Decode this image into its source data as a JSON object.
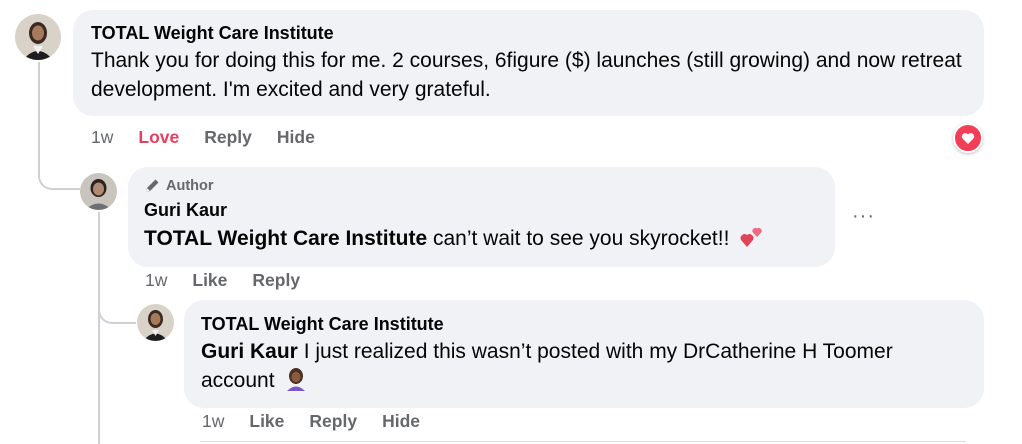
{
  "comment1": {
    "author": "TOTAL Weight Care Institute",
    "text": "Thank you for doing this for me. 2 courses, 6figure ($) launches (still growing) and now retreat development. I'm excited and very grateful.",
    "time": "1w",
    "love_label": "Love",
    "reply_label": "Reply",
    "hide_label": "Hide",
    "reaction_icon": "love-reaction-icon",
    "reaction_color": "#f33e58"
  },
  "reply1": {
    "badge_label": "Author",
    "author": "Guri Kaur",
    "mention": "TOTAL Weight Care Institute",
    "text": " can’t wait to see you skyrocket!!",
    "time": "1w",
    "like_label": "Like",
    "reply_label": "Reply",
    "more_label": "···"
  },
  "reply2": {
    "author": "TOTAL Weight Care Institute",
    "mention": "Guri Kaur",
    "text": " I just realized this wasn’t posted with my DrCatherine H Toomer account",
    "time": "1w",
    "like_label": "Like",
    "reply_label": "Reply",
    "hide_label": "Hide"
  },
  "colors": {
    "bubble_bg": "#f0f2f5",
    "secondary_text": "#65676b",
    "love_text": "#e4405f",
    "thread_line": "#ced0d4"
  }
}
